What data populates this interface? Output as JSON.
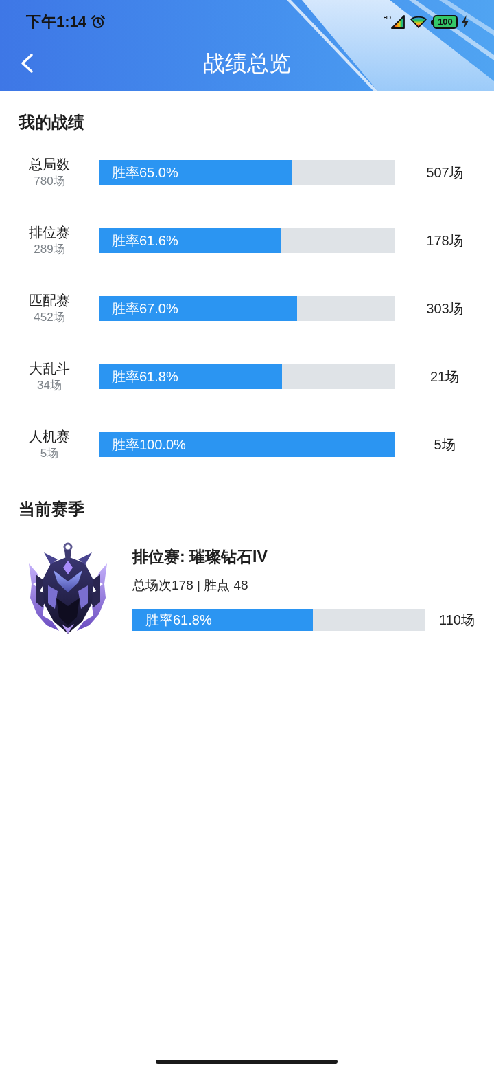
{
  "status_bar": {
    "time": "下午1:14",
    "network_label": "HD",
    "battery": "100",
    "charging": true
  },
  "header": {
    "title": "战绩总览"
  },
  "my_stats": {
    "title": "我的战绩",
    "rows": [
      {
        "mode": "总局数",
        "games": "780场",
        "win_rate": "胜率65.0%",
        "level": 0.65,
        "wins": "507场"
      },
      {
        "mode": "排位赛",
        "games": "289场",
        "win_rate": "胜率61.6%",
        "level": 0.616,
        "wins": "178场"
      },
      {
        "mode": "匹配赛",
        "games": "452场",
        "win_rate": "胜率67.0%",
        "level": 0.67,
        "wins": "303场"
      },
      {
        "mode": "大乱斗",
        "games": "34场",
        "win_rate": "胜率61.8%",
        "level": 0.618,
        "wins": "21场"
      },
      {
        "mode": "人机赛",
        "games": "5场",
        "win_rate": "胜率100.0%",
        "level": 1,
        "wins": "5场"
      }
    ]
  },
  "current_season": {
    "title": "当前赛季",
    "rank": "排位赛: 璀璨钻石IV",
    "summary": "总场次178 | 胜点 48",
    "win_rate": "胜率61.8%",
    "level": 0.618,
    "wins": "110场"
  }
}
